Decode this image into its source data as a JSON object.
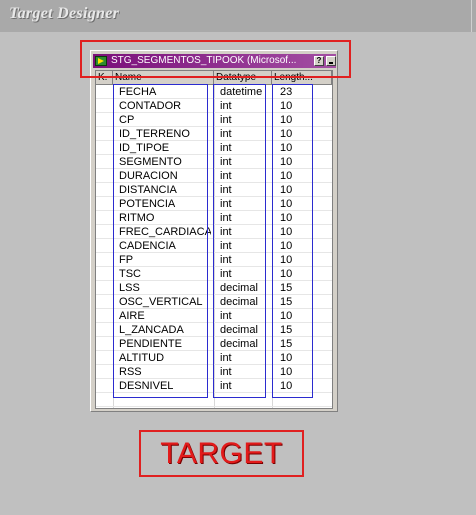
{
  "app": {
    "title": "Target Designer"
  },
  "table_window": {
    "title": "STG_SEGMENTOS_TIPOOK (Microsof...",
    "help_button": "?",
    "columns": {
      "key": "K.",
      "name": "Name",
      "datatype": "Datatype",
      "length": "Length..."
    },
    "rows": [
      {
        "name": "FECHA",
        "datatype": "datetime",
        "length": "23"
      },
      {
        "name": "CONTADOR",
        "datatype": "int",
        "length": "10"
      },
      {
        "name": "CP",
        "datatype": "int",
        "length": "10"
      },
      {
        "name": "ID_TERRENO",
        "datatype": "int",
        "length": "10"
      },
      {
        "name": "ID_TIPOE",
        "datatype": "int",
        "length": "10"
      },
      {
        "name": "SEGMENTO",
        "datatype": "int",
        "length": "10"
      },
      {
        "name": "DURACION",
        "datatype": "int",
        "length": "10"
      },
      {
        "name": "DISTANCIA",
        "datatype": "int",
        "length": "10"
      },
      {
        "name": "POTENCIA",
        "datatype": "int",
        "length": "10"
      },
      {
        "name": "RITMO",
        "datatype": "int",
        "length": "10"
      },
      {
        "name": "FREC_CARDIACA",
        "datatype": "int",
        "length": "10"
      },
      {
        "name": "CADENCIA",
        "datatype": "int",
        "length": "10"
      },
      {
        "name": "FP",
        "datatype": "int",
        "length": "10"
      },
      {
        "name": "TSC",
        "datatype": "int",
        "length": "10"
      },
      {
        "name": "LSS",
        "datatype": "decimal",
        "length": "15"
      },
      {
        "name": "OSC_VERTICAL",
        "datatype": "decimal",
        "length": "15"
      },
      {
        "name": "AIRE",
        "datatype": "int",
        "length": "10"
      },
      {
        "name": "L_ZANCADA",
        "datatype": "decimal",
        "length": "15"
      },
      {
        "name": "PENDIENTE",
        "datatype": "decimal",
        "length": "15"
      },
      {
        "name": "ALTITUD",
        "datatype": "int",
        "length": "10"
      },
      {
        "name": "RSS",
        "datatype": "int",
        "length": "10"
      },
      {
        "name": "DESNIVEL",
        "datatype": "int",
        "length": "10"
      }
    ]
  },
  "annotation": {
    "label": "TARGET"
  },
  "colors": {
    "title_bar": "#8b1a8b",
    "highlight_red": "#e02020",
    "highlight_blue": "#2b2bcf"
  }
}
